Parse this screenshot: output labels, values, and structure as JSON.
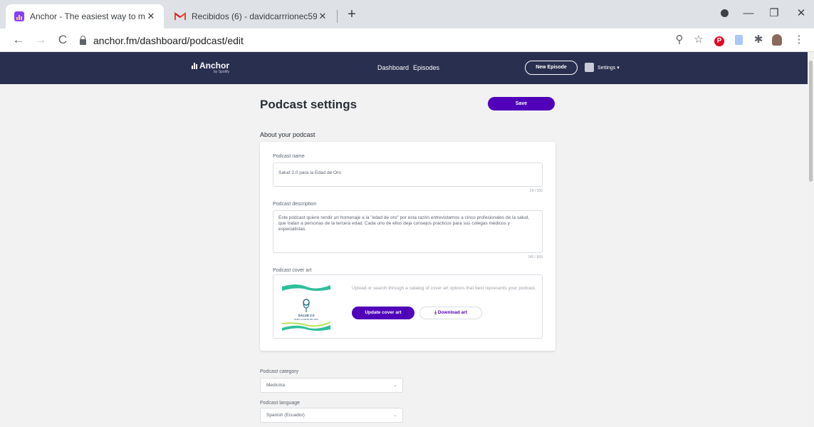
{
  "browser": {
    "tabs": [
      {
        "title": "Anchor - The easiest way to mak",
        "active": true,
        "favicon": "anchor-favicon"
      },
      {
        "title": "Recibidos (6) - davidcarrrionec59",
        "active": false,
        "favicon": "gmail-favicon"
      }
    ],
    "url": "anchor.fm/dashboard/podcast/edit"
  },
  "header": {
    "logo": "Anchor",
    "logo_sub": "by Spotify",
    "nav": [
      "Dashboard",
      "Episodes"
    ],
    "new_episode": "New Episode",
    "settings": "Settings"
  },
  "page": {
    "title": "Podcast settings",
    "save": "Save",
    "section_title": "About your podcast"
  },
  "form": {
    "name_label": "Podcast name",
    "name_value": "Salud 2.0 para la Edad de Oro",
    "name_counter": "29 / 100",
    "description_label": "Podcast description",
    "description_value": "Este pódcast quiere rendir un homenaje a la \"edad de oro\" por esta razón entrevistamos a cinco profesionales de la salud, que tratan a personas de la tercera edad. Cada uno de ellos deja consejos prácticos para sus colegas médicos y especialistas.",
    "description_counter": "245 / 600",
    "cover_label": "Podcast cover art",
    "cover_help": "Upload or search through a catalog of cover art options that best represents your podcast.",
    "cover_text": "SALUD 2.0",
    "cover_subtext": "PARA LA EDAD DE ORO",
    "update_cover": "Update cover art",
    "download_art": "Download art",
    "category_label": "Podcast category",
    "category_value": "Medicina",
    "language_label": "Podcast language",
    "language_value": "Spanish (Ecuador)"
  },
  "colors": {
    "header_bg": "#292f4f",
    "accent": "#5000b9"
  }
}
